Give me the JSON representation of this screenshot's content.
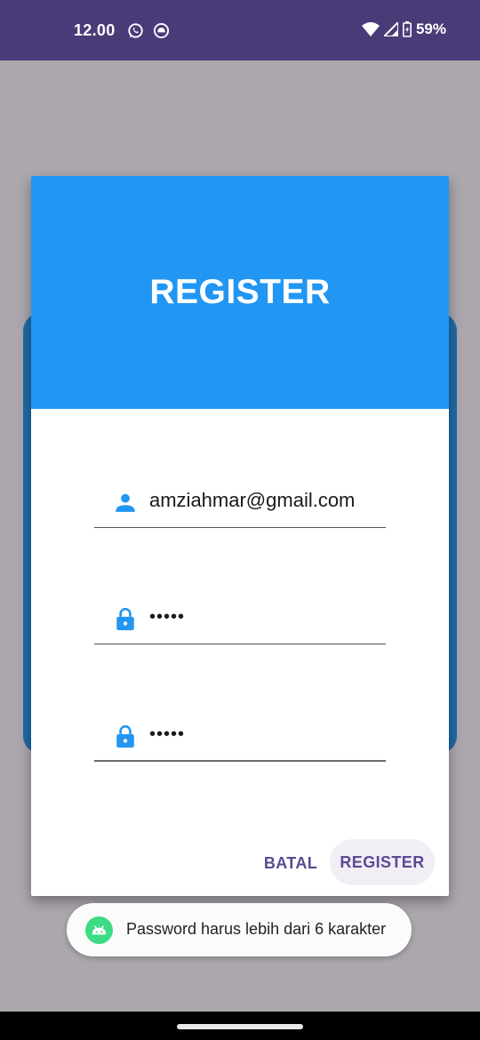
{
  "status_bar": {
    "time": "12.00",
    "app_icons": [
      "whatsapp-icon",
      "notification-app-icon"
    ],
    "battery_percent": "59%"
  },
  "dialog": {
    "title": "REGISTER",
    "fields": [
      {
        "icon": "person-icon",
        "value": "amziahmar@gmail.com"
      },
      {
        "icon": "lock-icon",
        "value": "•••••"
      },
      {
        "icon": "lock-icon",
        "value": "•••••"
      }
    ],
    "cancel_label": "BATAL",
    "register_label": "REGISTER"
  },
  "toast": {
    "message": "Password harus lebih dari 6 karakter"
  },
  "colors": {
    "status_bar": "#4a3b78",
    "header": "#2196f3",
    "icon": "#2196f3",
    "button_text": "#5b4a93"
  }
}
